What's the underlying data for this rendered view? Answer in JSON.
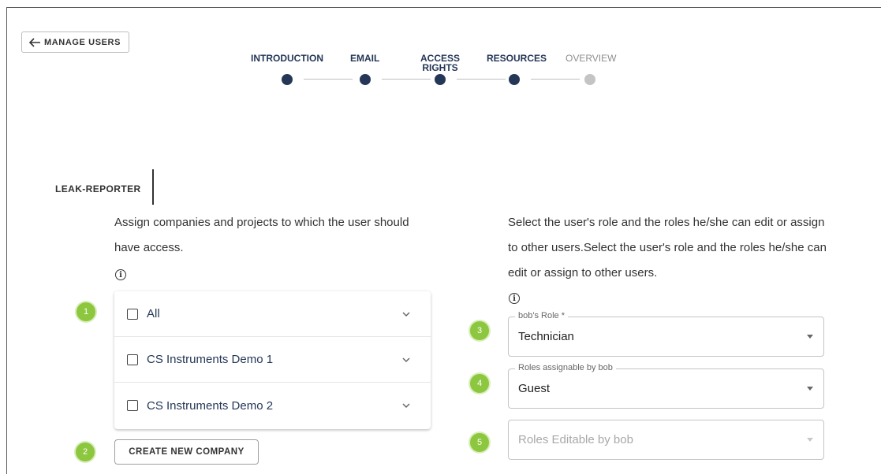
{
  "nav": {
    "back_label": "MANAGE USERS"
  },
  "stepper": {
    "steps": [
      {
        "label": "INTRODUCTION"
      },
      {
        "label": "EMAIL"
      },
      {
        "label": "ACCESS RIGHTS"
      },
      {
        "label": "RESOURCES"
      },
      {
        "label": "OVERVIEW"
      }
    ],
    "active_color": "#243757",
    "inactive_color": "#c4c4c4"
  },
  "section_tab": "LEAK-REPORTER",
  "left": {
    "description": "Assign companies and projects to which the user should have access.",
    "companies": [
      {
        "name": "All"
      },
      {
        "name": "CS Instruments Demo 1"
      },
      {
        "name": "CS Instruments Demo 2"
      }
    ],
    "create_label": "CREATE NEW COMPANY"
  },
  "right": {
    "description": "Select the user's role and the roles he/she can edit or assign to other users.Select the user's role and the roles he/she can edit or assign to other users.",
    "role_field": {
      "label": "bob's Role *",
      "value": "Technician"
    },
    "assignable_field": {
      "label": "Roles assignable by bob",
      "value": "Guest"
    },
    "editable_field": {
      "placeholder": "Roles Editable by bob"
    }
  },
  "badges": [
    "1",
    "2",
    "3",
    "4",
    "5"
  ],
  "badge_color": "#8dc63f"
}
